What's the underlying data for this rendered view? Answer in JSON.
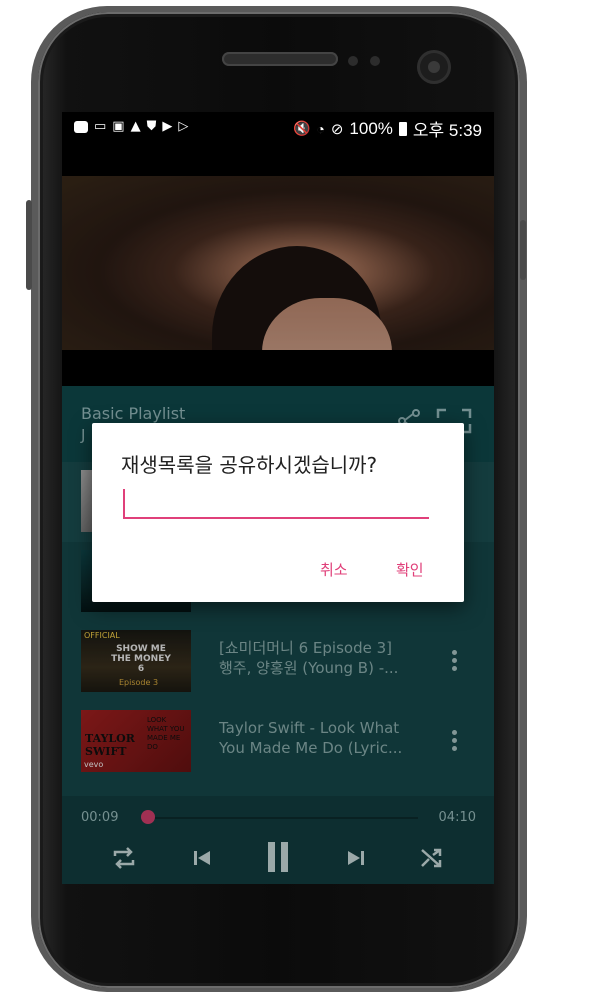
{
  "status_bar": {
    "left_icons": [
      "pay-icon",
      "cast-icon",
      "image-icon",
      "warning-icon",
      "shield-icon",
      "play-icon",
      "play-outline-icon"
    ],
    "battery": "100%",
    "time": "오후 5:39"
  },
  "playlist": {
    "title": "Basic Playlist",
    "subtitle_partial": "J"
  },
  "tracks": [
    {
      "title_line1": "",
      "title_line2": "",
      "thumb_label": "",
      "accent": "#888888"
    },
    {
      "title_line1": "",
      "title_line2": "",
      "thumb_label": "",
      "accent": "#0c3a3b"
    },
    {
      "title_line1": "[쇼미더머니 6 Episode 3]",
      "title_line2": "행주, 양홍원 (Young B) -...",
      "thumb_label": "OFFICIAL",
      "thumb_text": "SHOW ME THE MONEY 6",
      "thumb_sub": "Episode 3",
      "accent": "#2a2316"
    },
    {
      "title_line1": "Taylor Swift - Look What",
      "title_line2": "You Made Me Do (Lyric...",
      "thumb_label": "vevo",
      "thumb_text": "TAYLOR SWIFT",
      "thumb_sub": "LOOK WHAT YOU MADE ME DO",
      "accent": "#7a1a1a"
    }
  ],
  "player": {
    "elapsed": "00:09",
    "duration": "04:10",
    "progress": 0.036
  },
  "dialog": {
    "title": "재생목록을 공유하시겠습니까?",
    "input_value": "",
    "cancel": "취소",
    "confirm": "확인"
  },
  "colors": {
    "accent": "#e0407a",
    "panel": "#16494b"
  }
}
